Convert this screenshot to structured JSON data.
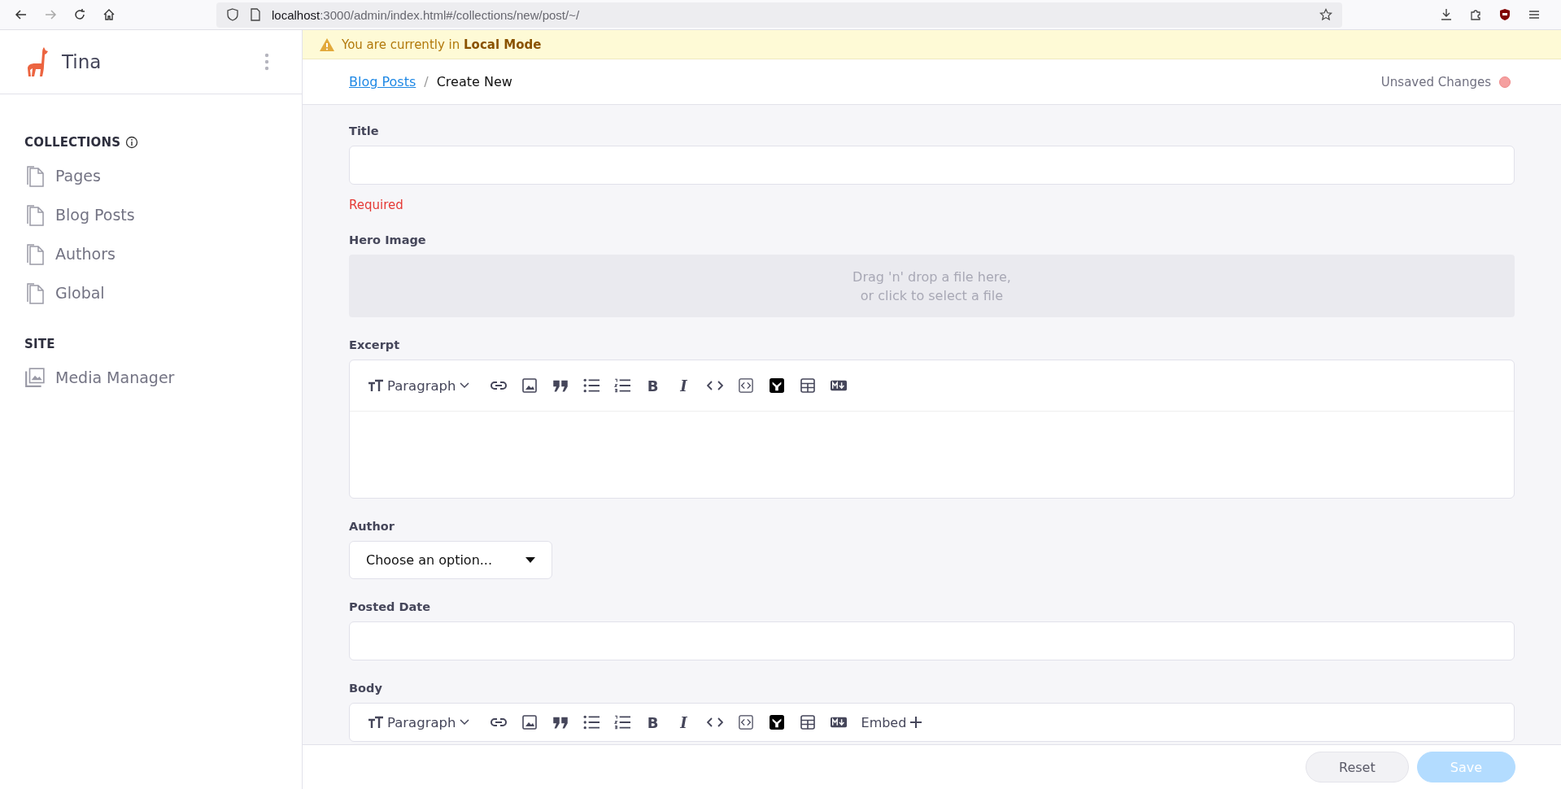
{
  "browser": {
    "host": "localhost",
    "path": ":3000/admin/index.html#/collections/new/post/~/"
  },
  "sidebar": {
    "brand": "Tina",
    "sections": [
      {
        "title": "COLLECTIONS",
        "info": true,
        "items": [
          {
            "label": "Pages",
            "kind": "document"
          },
          {
            "label": "Blog Posts",
            "kind": "document"
          },
          {
            "label": "Authors",
            "kind": "document"
          },
          {
            "label": "Global",
            "kind": "document"
          }
        ]
      },
      {
        "title": "SITE",
        "info": false,
        "items": [
          {
            "label": "Media Manager",
            "kind": "media"
          }
        ]
      }
    ]
  },
  "banner": {
    "text": "You are currently in **Local Mode**"
  },
  "header": {
    "breadcrumb": {
      "link": "Blog Posts",
      "separator": "/",
      "current": "Create New"
    },
    "status": {
      "label": "Unsaved Changes",
      "dirty": true
    }
  },
  "fields": [
    {
      "kind": "text",
      "label": "Title",
      "error": "Required"
    },
    {
      "kind": "image",
      "label": "Hero Image",
      "placeholder_lines": [
        "Drag 'n' drop a file here,",
        "or click to select a file"
      ]
    },
    {
      "kind": "rich-text",
      "label": "Excerpt",
      "toolbar": [
        {
          "kind": "dropdown",
          "label": "Paragraph"
        },
        {
          "kind": "link"
        },
        {
          "kind": "image"
        },
        {
          "kind": "quote"
        },
        {
          "kind": "bullets"
        },
        {
          "kind": "numbers"
        },
        {
          "kind": "bold",
          "label": "B"
        },
        {
          "kind": "italic",
          "label": "I"
        },
        {
          "kind": "code"
        },
        {
          "kind": "code-block"
        },
        {
          "kind": "y-logo"
        },
        {
          "kind": "table"
        },
        {
          "kind": "markdown"
        }
      ]
    },
    {
      "kind": "select",
      "label": "Author",
      "value": "Choose an option..."
    },
    {
      "kind": "text",
      "label": "Posted Date"
    },
    {
      "kind": "rich-text",
      "label": "Body",
      "toolbar": [
        {
          "kind": "dropdown",
          "label": "Paragraph"
        },
        {
          "kind": "link"
        },
        {
          "kind": "image"
        },
        {
          "kind": "quote"
        },
        {
          "kind": "bullets"
        },
        {
          "kind": "numbers"
        },
        {
          "kind": "bold",
          "label": "B"
        },
        {
          "kind": "italic",
          "label": "I"
        },
        {
          "kind": "code"
        },
        {
          "kind": "code-block"
        },
        {
          "kind": "y-logo"
        },
        {
          "kind": "table"
        },
        {
          "kind": "markdown"
        },
        {
          "kind": "embed",
          "label": "Embed"
        }
      ]
    }
  ],
  "footer": {
    "buttons": [
      {
        "label": "Reset",
        "kind": "secondary",
        "disabled": false
      },
      {
        "label": "Save",
        "kind": "primary",
        "disabled": true
      }
    ]
  }
}
